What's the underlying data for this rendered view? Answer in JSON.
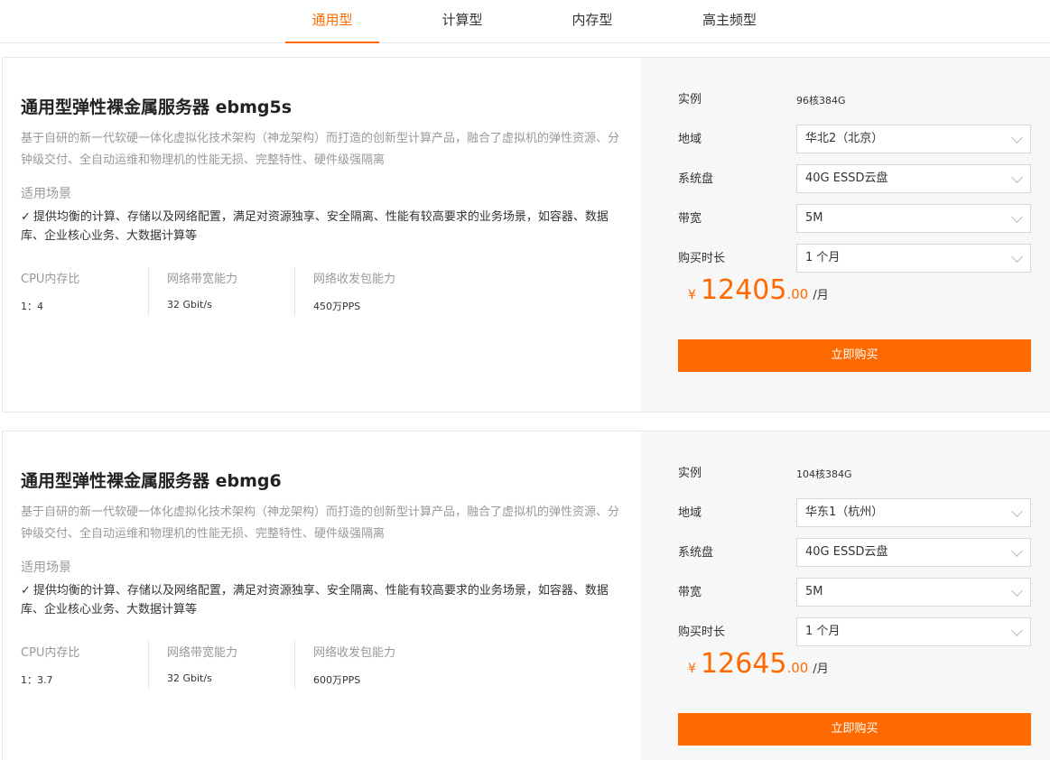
{
  "tabs": [
    {
      "label": "通用型",
      "active": true
    },
    {
      "label": "计算型",
      "active": false
    },
    {
      "label": "内存型",
      "active": false
    },
    {
      "label": "高主频型",
      "active": false
    }
  ],
  "colors": {
    "accent": "#ff6a00",
    "panel_bg": "#f7f7f7",
    "muted_text": "#999999"
  },
  "products": [
    {
      "title": "通用型弹性裸金属服务器 ebmg5s",
      "description": "基于自研的新一代软硬一体化虚拟化技术架构（神龙架构）而打造的创新型计算产品，融合了虚拟机的弹性资源、分钟级交付、全自动运维和物理机的性能无损、完整特性、硬件级强隔离",
      "scenario_label": "适用场景",
      "scenario_check_icon": "✓",
      "scenario_text": "提供均衡的计算、存储以及网络配置，满足对资源独享、安全隔离、性能有较高要求的业务场景，如容器、数据库、企业核心业务、大数据计算等",
      "specs": [
        {
          "label": "CPU内存比",
          "value": "1：4"
        },
        {
          "label": "网络带宽能力",
          "value": "32 Gbit/s"
        },
        {
          "label": "网络收发包能力",
          "value": "450万PPS"
        }
      ],
      "config": {
        "instance_label": "实例",
        "instance_value": "96核384G",
        "region_label": "地域",
        "region_value": "华北2（北京）",
        "disk_label": "系统盘",
        "disk_value": "40G ESSD云盘",
        "bandwidth_label": "带宽",
        "bandwidth_value": "5M",
        "duration_label": "购买时长",
        "duration_value": "1 个月"
      },
      "price": {
        "currency": "¥",
        "integer": "12405",
        "decimal": ".00",
        "unit": "/月"
      },
      "buy_label": "立即购买"
    },
    {
      "title": "通用型弹性裸金属服务器 ebmg6",
      "description": "基于自研的新一代软硬一体化虚拟化技术架构（神龙架构）而打造的创新型计算产品，融合了虚拟机的弹性资源、分钟级交付、全自动运维和物理机的性能无损、完整特性、硬件级强隔离",
      "scenario_label": "适用场景",
      "scenario_check_icon": "✓",
      "scenario_text": "提供均衡的计算、存储以及网络配置，满足对资源独享、安全隔离、性能有较高要求的业务场景，如容器、数据库、企业核心业务、大数据计算等",
      "specs": [
        {
          "label": "CPU内存比",
          "value": "1：3.7"
        },
        {
          "label": "网络带宽能力",
          "value": "32 Gbit/s"
        },
        {
          "label": "网络收发包能力",
          "value": "600万PPS"
        }
      ],
      "config": {
        "instance_label": "实例",
        "instance_value": "104核384G",
        "region_label": "地域",
        "region_value": "华东1（杭州）",
        "disk_label": "系统盘",
        "disk_value": "40G ESSD云盘",
        "bandwidth_label": "带宽",
        "bandwidth_value": "5M",
        "duration_label": "购买时长",
        "duration_value": "1 个月"
      },
      "price": {
        "currency": "¥",
        "integer": "12645",
        "decimal": ".00",
        "unit": "/月"
      },
      "buy_label": "立即购买"
    }
  ]
}
